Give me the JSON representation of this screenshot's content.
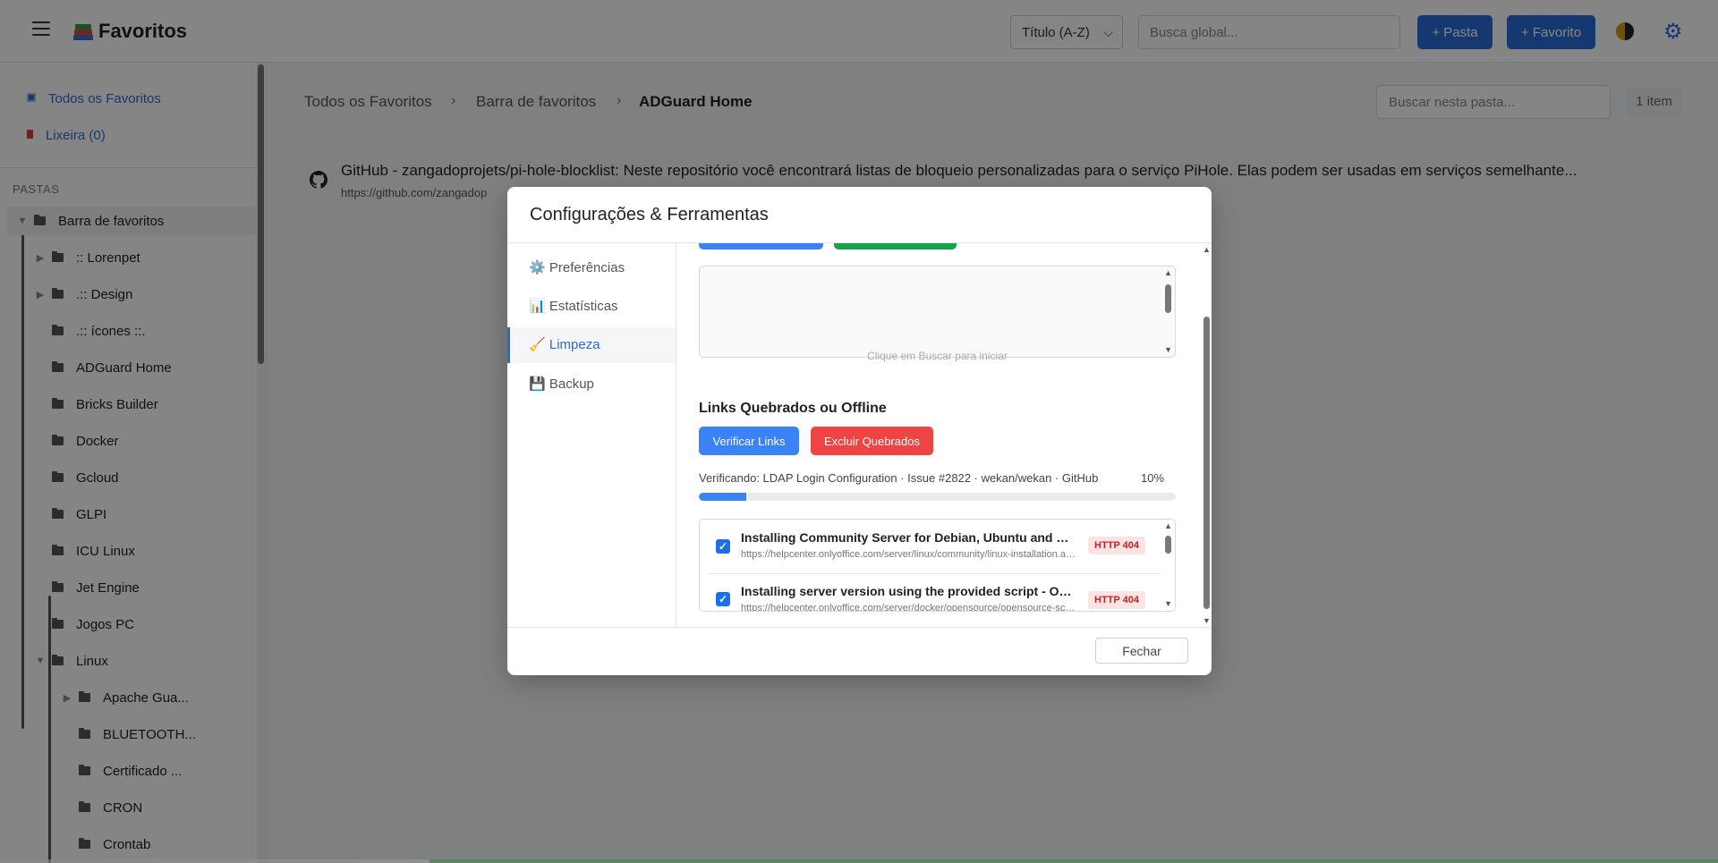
{
  "header": {
    "app_title": "Favoritos",
    "sort_value": "Título (A-Z)",
    "global_search_placeholder": "Busca global...",
    "new_folder_label": "+ Pasta",
    "new_bookmark_label": "+ Favorito"
  },
  "sidebar": {
    "all_label": "Todos os Favoritos",
    "trash_label": "Lixeira (0)",
    "folders_title": "PASTAS",
    "tree": [
      {
        "label": "Barra de favoritos",
        "arrow": "▼"
      },
      {
        "label": ":: Lorenpet",
        "arrow": "▶"
      },
      {
        "label": ".:: Design",
        "arrow": "▶"
      },
      {
        "label": ".:: ícones ::.",
        "arrow": ""
      },
      {
        "label": "ADGuard Home",
        "arrow": ""
      },
      {
        "label": "Bricks Builder",
        "arrow": ""
      },
      {
        "label": "Docker",
        "arrow": ""
      },
      {
        "label": "Gcloud",
        "arrow": ""
      },
      {
        "label": "GLPI",
        "arrow": ""
      },
      {
        "label": "ICU Linux",
        "arrow": ""
      },
      {
        "label": "Jet Engine",
        "arrow": ""
      },
      {
        "label": "Jogos PC",
        "arrow": ""
      },
      {
        "label": "Linux",
        "arrow": "▼"
      },
      {
        "label": "Apache Gua...",
        "arrow": "▶"
      },
      {
        "label": "BLUETOOTH...",
        "arrow": ""
      },
      {
        "label": "Certificado ...",
        "arrow": ""
      },
      {
        "label": "CRON",
        "arrow": ""
      },
      {
        "label": "Crontab",
        "arrow": ""
      }
    ]
  },
  "main": {
    "breadcrumb": [
      "Todos os Favoritos",
      "Barra de favoritos",
      "ADGuard Home"
    ],
    "breadcrumb_sep": "›",
    "folder_search_placeholder": "Buscar nesta pasta...",
    "item_count": "1 item",
    "bookmark": {
      "title": "GitHub - zangadoprojets/pi-hole-blocklist: Neste repositório você encontrará listas de bloqueio personalizadas para o serviço PiHole. Elas podem ser usadas em serviços semelhante...",
      "url": "https://github.com/zangadop"
    }
  },
  "modal": {
    "title": "Configurações & Ferramentas",
    "nav": [
      {
        "icon": "⚙️",
        "label": "Preferências"
      },
      {
        "icon": "📊",
        "label": "Estatísticas"
      },
      {
        "icon": "🧹",
        "label": "Limpeza"
      },
      {
        "icon": "💾",
        "label": "Backup"
      }
    ],
    "active_nav": "Limpeza",
    "log_hint": "Clique em Buscar para iniciar",
    "section_title": "Links Quebrados ou Offline",
    "verify_label": "Verificar Links",
    "delete_label": "Excluir Quebrados",
    "progress_text": "Verificando: LDAP Login Configuration · Issue #2822 · wekan/wekan · GitHub",
    "progress_pct_label": "10%",
    "progress_fraction": 0.1,
    "results": [
      {
        "title": "Installing Community Server for Debian, Ubuntu and derivatives",
        "url": "https://helpcenter.onlyoffice.com/server/linux/community/linux-installation.aspx",
        "status": "HTTP 404",
        "checked": true
      },
      {
        "title": "Installing server version using the provided script - ONLYOFFICE",
        "url": "https://helpcenter.onlyoffice.com/server/docker/opensource/opensource-script-installation.aspx",
        "status": "HTTP 404",
        "checked": true
      }
    ],
    "close_label": "Fechar"
  },
  "colors": {
    "primary": "#2b6bd6",
    "accent_blue": "#3b82f6",
    "danger": "#ef4444",
    "badge_bg": "#fde4e4",
    "badge_text": "#c82020"
  }
}
